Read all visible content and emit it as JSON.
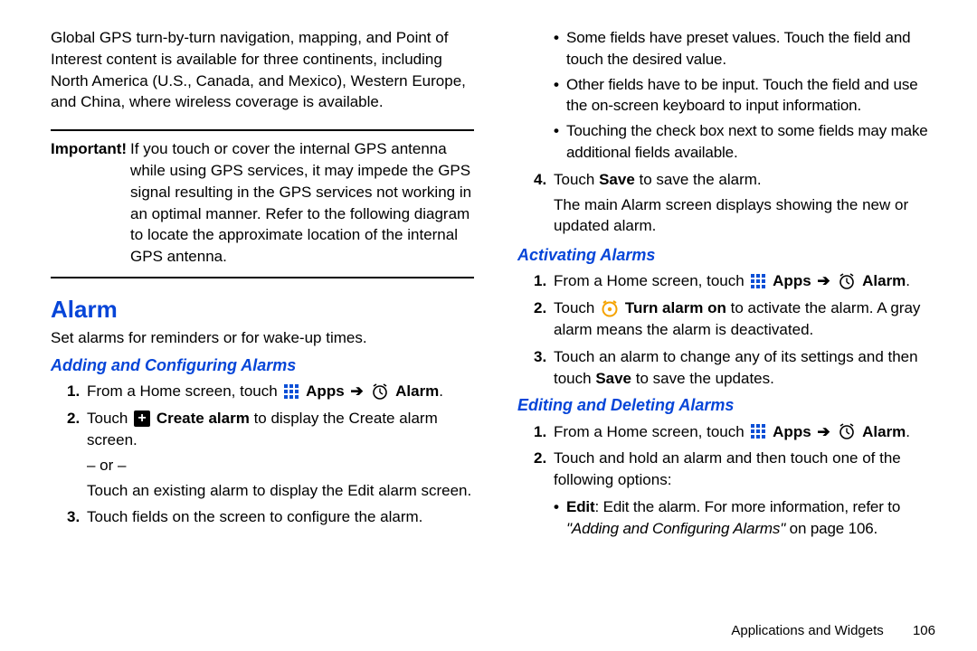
{
  "leftCol": {
    "intro": "Global GPS turn-by-turn navigation, mapping, and Point of Interest content is available for three continents, including North America (U.S., Canada, and Mexico), Western Europe, and China, where wireless coverage is available.",
    "important": {
      "label": "Important!",
      "text": "If you touch or cover the internal GPS antenna while using GPS services, it may impede the GPS signal resulting in the GPS services not working in an optimal manner. Refer to the following diagram to locate the approximate location of the internal GPS antenna."
    },
    "h1": "Alarm",
    "desc": "Set alarms for reminders or for wake-up times.",
    "h2": "Adding and Configuring Alarms",
    "steps": {
      "s1_pre": "From a Home screen, touch ",
      "apps": "Apps",
      "alarm": "Alarm",
      "s2_touch": "Touch ",
      "s2_createAlarm": "Create alarm",
      "s2_rest": " to display the Create alarm screen.",
      "or": "– or –",
      "s2_orText": "Touch an existing alarm to display the Edit alarm screen.",
      "s3": "Touch fields on the screen to configure the alarm."
    }
  },
  "rightCol": {
    "topBullets": {
      "b1": "Some fields have preset values. Touch the field and touch the desired value.",
      "b2": "Other fields have to be input. Touch the field and use the on-screen keyboard to input information.",
      "b3": "Touching the check box next to some fields may make additional fields available."
    },
    "s4_touch": "Touch ",
    "s4_save": "Save",
    "s4_rest": " to save the alarm.",
    "afterSave": "The main Alarm screen displays showing the new or updated alarm.",
    "h2_activating": "Activating Alarms",
    "act": {
      "s1_pre": "From a Home screen, touch ",
      "apps": "Apps",
      "alarm": "Alarm",
      "s2_touch": "Touch ",
      "s2_turnon": "Turn alarm on",
      "s2_rest": " to activate the alarm. A gray alarm means the alarm is deactivated.",
      "s3_a": "Touch an alarm to change any of its settings and then touch ",
      "s3_save": "Save",
      "s3_b": " to save the updates."
    },
    "h2_editing": "Editing and Deleting Alarms",
    "edit": {
      "s1_pre": "From a Home screen, touch ",
      "apps": "Apps",
      "alarm": "Alarm",
      "s2": "Touch and hold an alarm and then touch one of the following options:",
      "bullet_label": "Edit",
      "bullet_text": ": Edit the alarm. For more information, refer to ",
      "bullet_ref": "\"Adding and Configuring Alarms\"",
      "bullet_page": " on page 106."
    }
  },
  "footer": {
    "chapter": "Applications and Widgets",
    "page": "106"
  }
}
